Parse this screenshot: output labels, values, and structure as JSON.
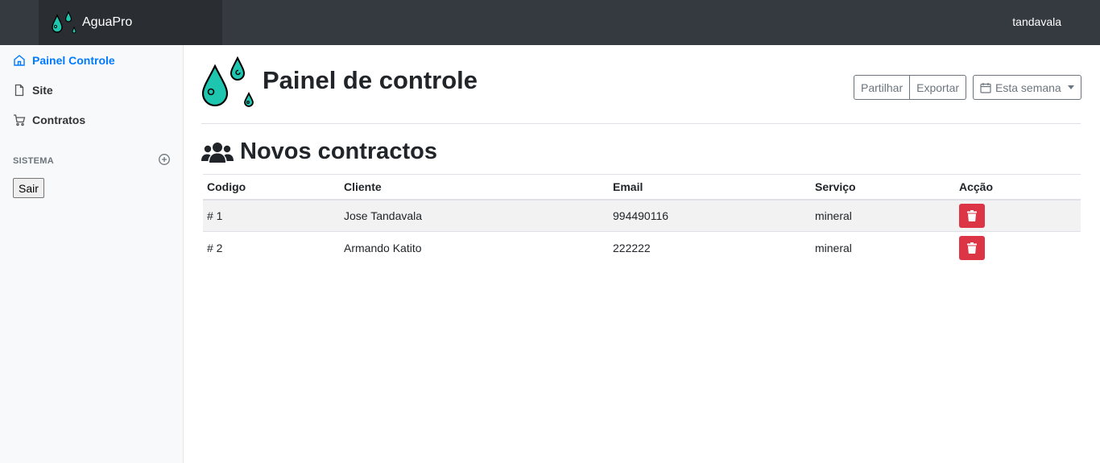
{
  "navbar": {
    "brand": "AguaPro",
    "user": "tandavala"
  },
  "sidebar": {
    "items": [
      {
        "label": "Painel Controle",
        "icon": "home-icon",
        "active": true
      },
      {
        "label": "Site",
        "icon": "file-icon",
        "active": false
      },
      {
        "label": "Contratos",
        "icon": "cart-icon",
        "active": false
      }
    ],
    "section_heading": "SISTEMA",
    "logout_label": "Sair"
  },
  "main": {
    "title": "Painel de controle",
    "share_label": "Partilhar",
    "export_label": "Exportar",
    "period_label": "Esta semana",
    "section_title": "Novos contractos",
    "table": {
      "headers": [
        "Codigo",
        "Cliente",
        "Email",
        "Serviço",
        "Acção"
      ],
      "rows": [
        {
          "code": "# 1",
          "client": "Jose Tandavala",
          "email": "994490116",
          "service": "mineral"
        },
        {
          "code": "# 2",
          "client": "Armando Katito",
          "email": "222222",
          "service": "mineral"
        }
      ]
    }
  },
  "colors": {
    "accent": "#007bff",
    "danger": "#dc3545",
    "navbar": "#343a40",
    "drop": "#1ec6b0"
  }
}
